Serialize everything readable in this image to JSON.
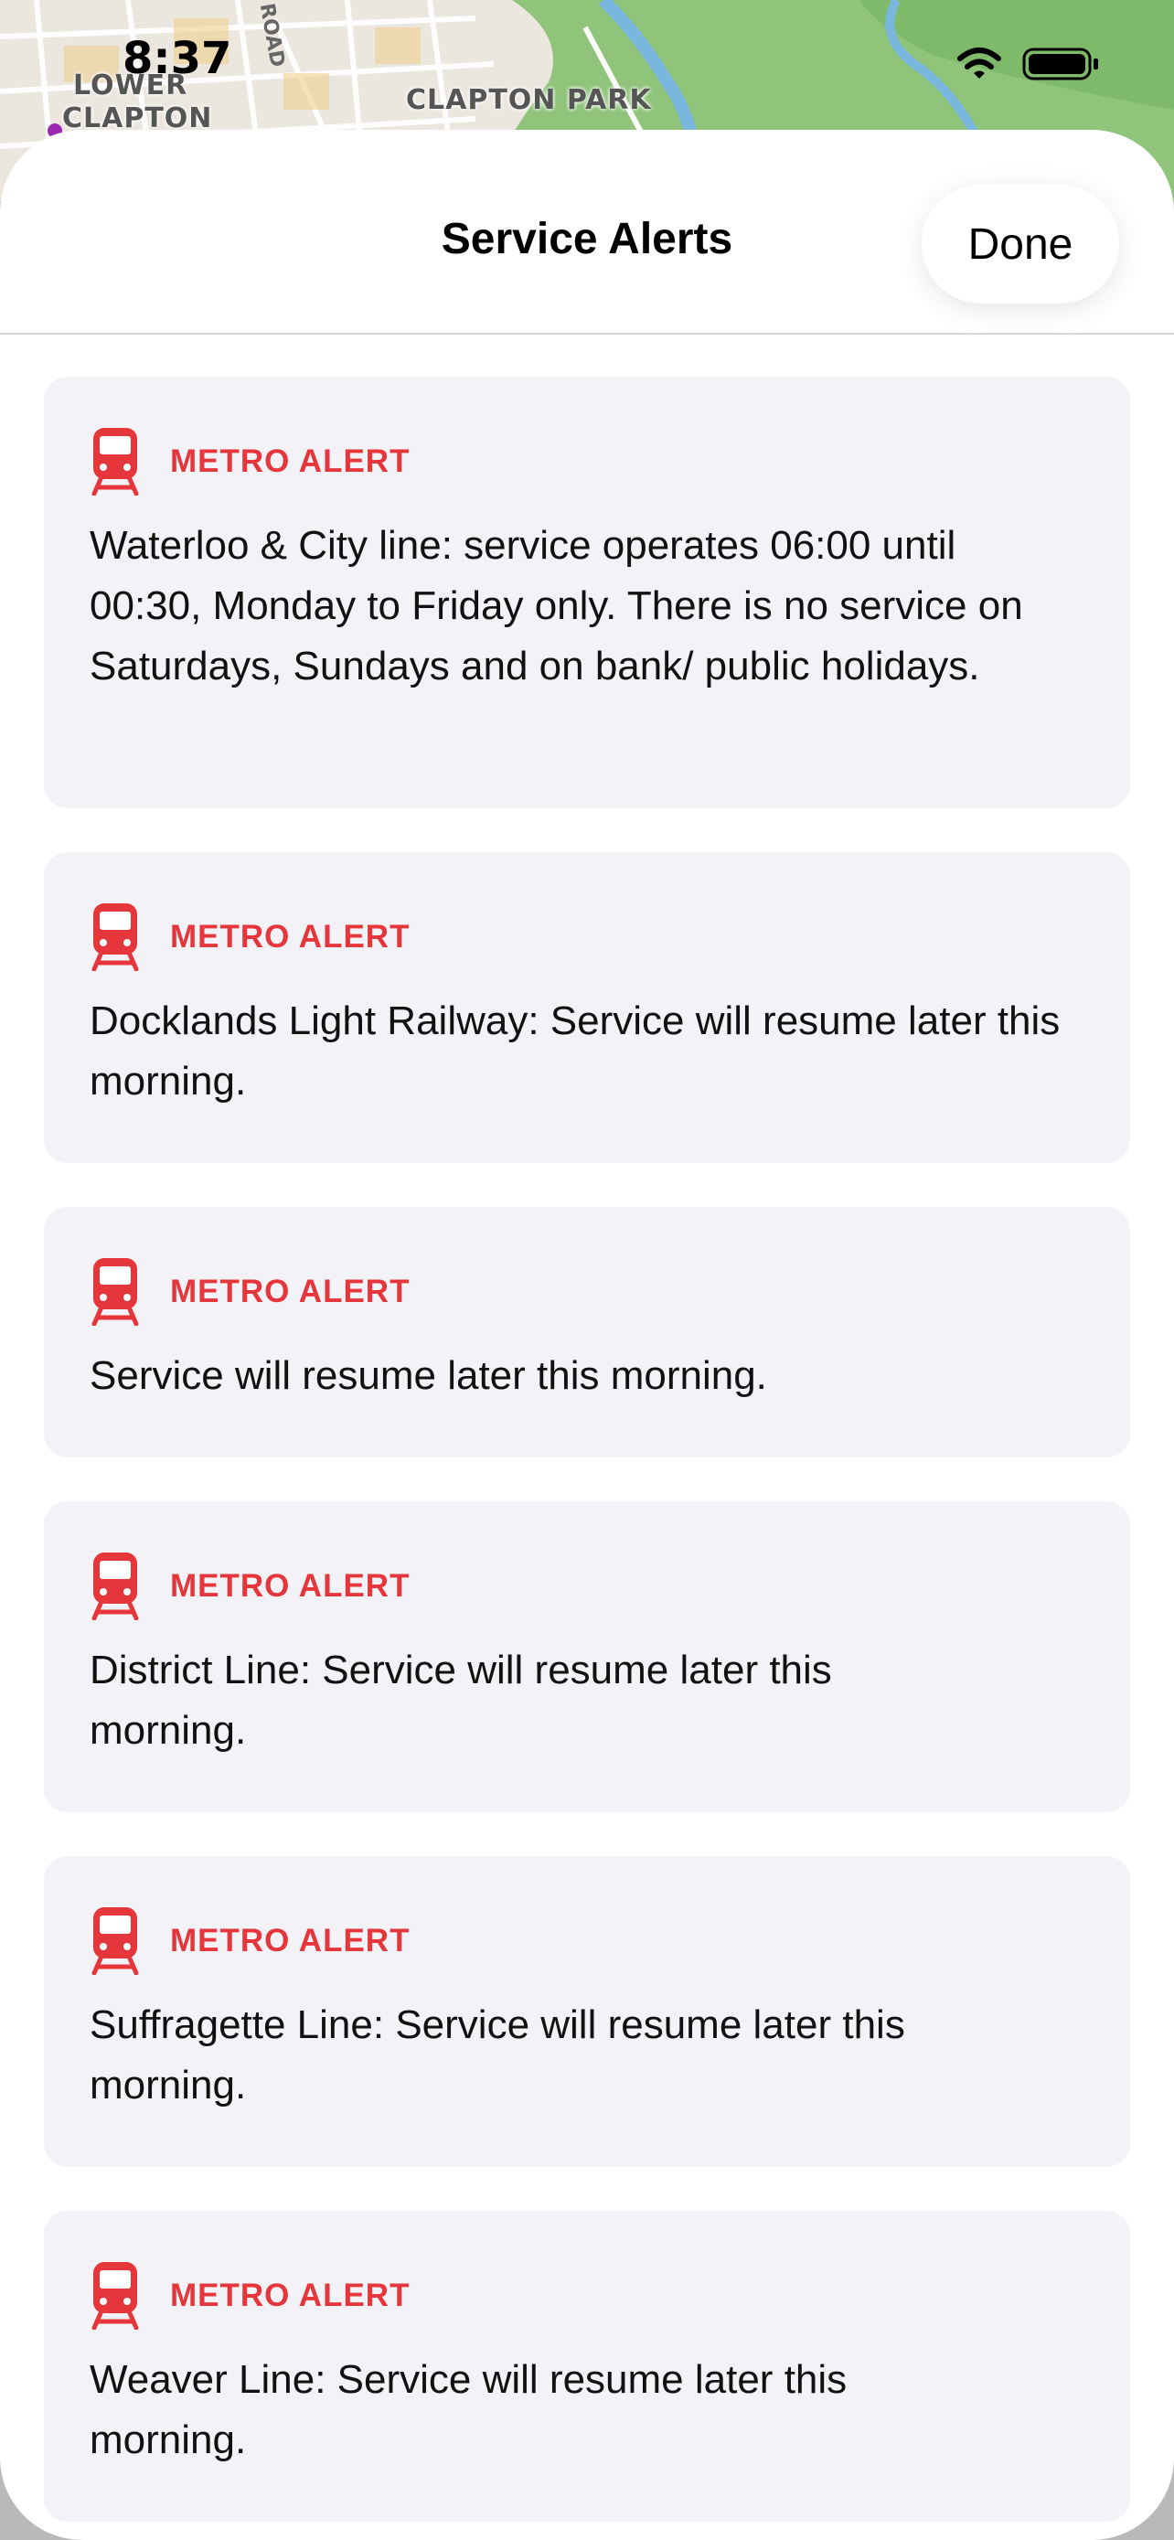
{
  "status_bar": {
    "time": "8:37",
    "icons": [
      "wifi-icon",
      "battery-icon"
    ]
  },
  "map": {
    "labels": {
      "lower": "LOWER",
      "clapton": "CLAPTON",
      "clapton_park": "CLAPTON PARK",
      "road": "ROAD"
    }
  },
  "sheet": {
    "title": "Service Alerts",
    "done_label": "Done"
  },
  "colors": {
    "alert_red": "#e5363b",
    "card_bg": "#f2f2f7"
  },
  "alerts": [
    {
      "kind": "METRO ALERT",
      "icon": "train-icon",
      "text": "Waterloo & City line: service operates 06:00 until 00:30, Monday to Friday only. There is no service on Saturdays, Sundays and on bank/ public holidays."
    },
    {
      "kind": "METRO ALERT",
      "icon": "train-icon",
      "text": "Docklands Light Railway: Service will resume later this morning."
    },
    {
      "kind": "METRO ALERT",
      "icon": "train-icon",
      "text": "Service will resume later this morning."
    },
    {
      "kind": "METRO ALERT",
      "icon": "train-icon",
      "text": "District Line: Service will resume later this morning."
    },
    {
      "kind": "METRO ALERT",
      "icon": "train-icon",
      "text": "Suffragette Line: Service will resume later this morning."
    },
    {
      "kind": "METRO ALERT",
      "icon": "train-icon",
      "text": "Weaver Line: Service will resume later this morning."
    }
  ]
}
